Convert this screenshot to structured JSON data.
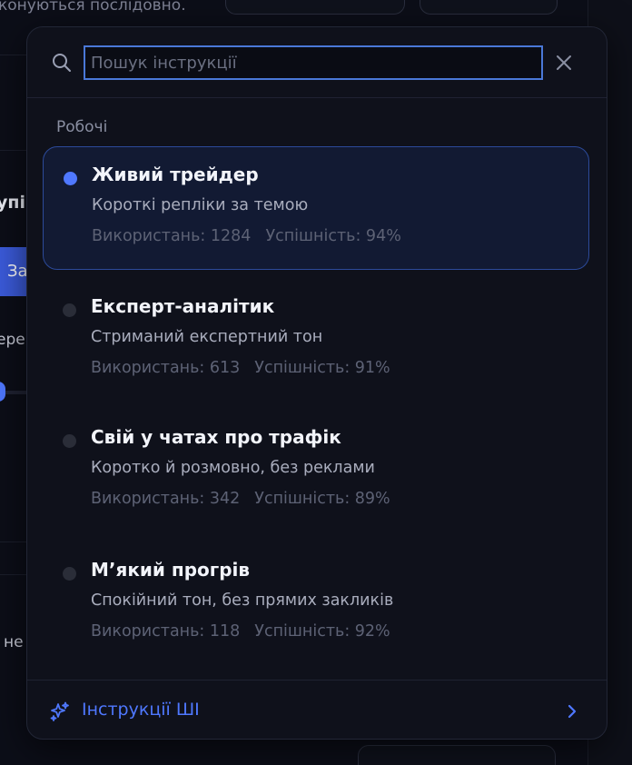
{
  "background": {
    "top_text": "конуються послідовно.",
    "side_texts": [
      "упі",
      "За",
      "ере",
      "не"
    ]
  },
  "search": {
    "placeholder": "Пошук інструкції",
    "value": ""
  },
  "group": {
    "label": "Робочі"
  },
  "instructions": [
    {
      "title": "Живий трейдер",
      "description": "Короткі репліки за темою",
      "usage_label": "Використань: 1284",
      "success_label": "Успішність: 94%",
      "selected": true
    },
    {
      "title": "Експерт-аналітик",
      "description": "Стриманий експертний тон",
      "usage_label": "Використань: 613",
      "success_label": "Успішність: 91%",
      "selected": false
    },
    {
      "title": "Свій у чатах про трафік",
      "description": "Коротко й розмовно, без реклами",
      "usage_label": "Використань: 342",
      "success_label": "Успішність: 89%",
      "selected": false
    },
    {
      "title": "М’який прогрів",
      "description": "Спокійний тон, без прямих закликів",
      "usage_label": "Використань: 118",
      "success_label": "Успішність: 92%",
      "selected": false
    }
  ],
  "footer": {
    "label": "Інструкції ШІ"
  },
  "colors": {
    "accent": "#4f78ff",
    "panel": "#0f111b",
    "selected_bg": "#121a33",
    "selected_border": "#2c4a9a",
    "search_focus": "#4a78d8"
  },
  "icons": {
    "search": "search-icon",
    "close": "close-icon",
    "sparkle": "sparkle-icon",
    "chevron": "chevron-right-icon"
  }
}
